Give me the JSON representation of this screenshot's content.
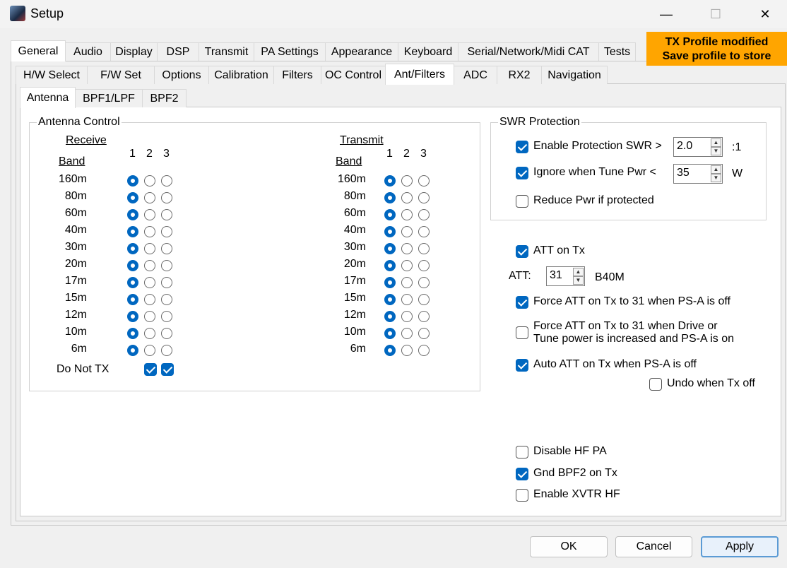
{
  "window": {
    "title": "Setup",
    "minimize": "—",
    "maximize": "☐",
    "close": "✕"
  },
  "tabs_main": [
    "General",
    "Audio",
    "Display",
    "DSP",
    "Transmit",
    "PA Settings",
    "Appearance",
    "Keyboard",
    "Serial/Network/Midi CAT",
    "Tests"
  ],
  "tabs_sub": [
    "H/W Select",
    "F/W Set",
    "Options",
    "Calibration",
    "Filters",
    "OC Control",
    "Ant/Filters",
    "ADC",
    "RX2",
    "Navigation"
  ],
  "tabs_inner": [
    "Antenna",
    "BPF1/LPF",
    "BPF2"
  ],
  "tx_banner": {
    "line1": "TX Profile modified",
    "line2": "Save profile to store"
  },
  "antenna_control": {
    "title": "Antenna Control",
    "receive_label": "Receive",
    "transmit_label": "Transmit",
    "band_label": "Band",
    "col_headers": [
      "1",
      "2",
      "3"
    ],
    "bands": [
      "160m",
      "80m",
      "60m",
      "40m",
      "30m",
      "20m",
      "17m",
      "15m",
      "12m",
      "10m",
      "6m"
    ],
    "receive_selected": 1,
    "transmit_selected": 1,
    "do_not_tx_label": "Do Not TX",
    "do_not_tx": [
      true,
      true
    ]
  },
  "swr_protection": {
    "title": "SWR Protection",
    "enable_label": "Enable Protection SWR >",
    "enable_checked": true,
    "swr_value": "2.0",
    "swr_unit": ":1",
    "ignore_label": "Ignore when Tune Pwr <",
    "ignore_checked": true,
    "tune_pwr_value": "35",
    "tune_pwr_unit": "W",
    "reduce_label": "Reduce Pwr if protected",
    "reduce_checked": false
  },
  "att": {
    "att_on_tx_label": "ATT on Tx",
    "att_on_tx_checked": true,
    "att_label": "ATT:",
    "att_value": "31",
    "band_text": "B40M",
    "force_off_label": "Force ATT on Tx to 31 when PS-A is off",
    "force_off_checked": true,
    "force_drive_label_1": "Force ATT on Tx to 31 when Drive or",
    "force_drive_label_2": "Tune power is increased and PS-A is on",
    "force_drive_checked": false,
    "auto_att_label": "Auto ATT on Tx when PS-A is off",
    "auto_att_checked": true,
    "undo_label": "Undo when Tx off",
    "undo_checked": false
  },
  "misc": {
    "disable_hf_pa_label": "Disable HF PA",
    "disable_hf_pa_checked": false,
    "gnd_bpf2_label": "Gnd BPF2 on Tx",
    "gnd_bpf2_checked": true,
    "enable_xvtr_label": "Enable XVTR HF",
    "enable_xvtr_checked": false
  },
  "buttons": {
    "ok": "OK",
    "cancel": "Cancel",
    "apply": "Apply"
  }
}
